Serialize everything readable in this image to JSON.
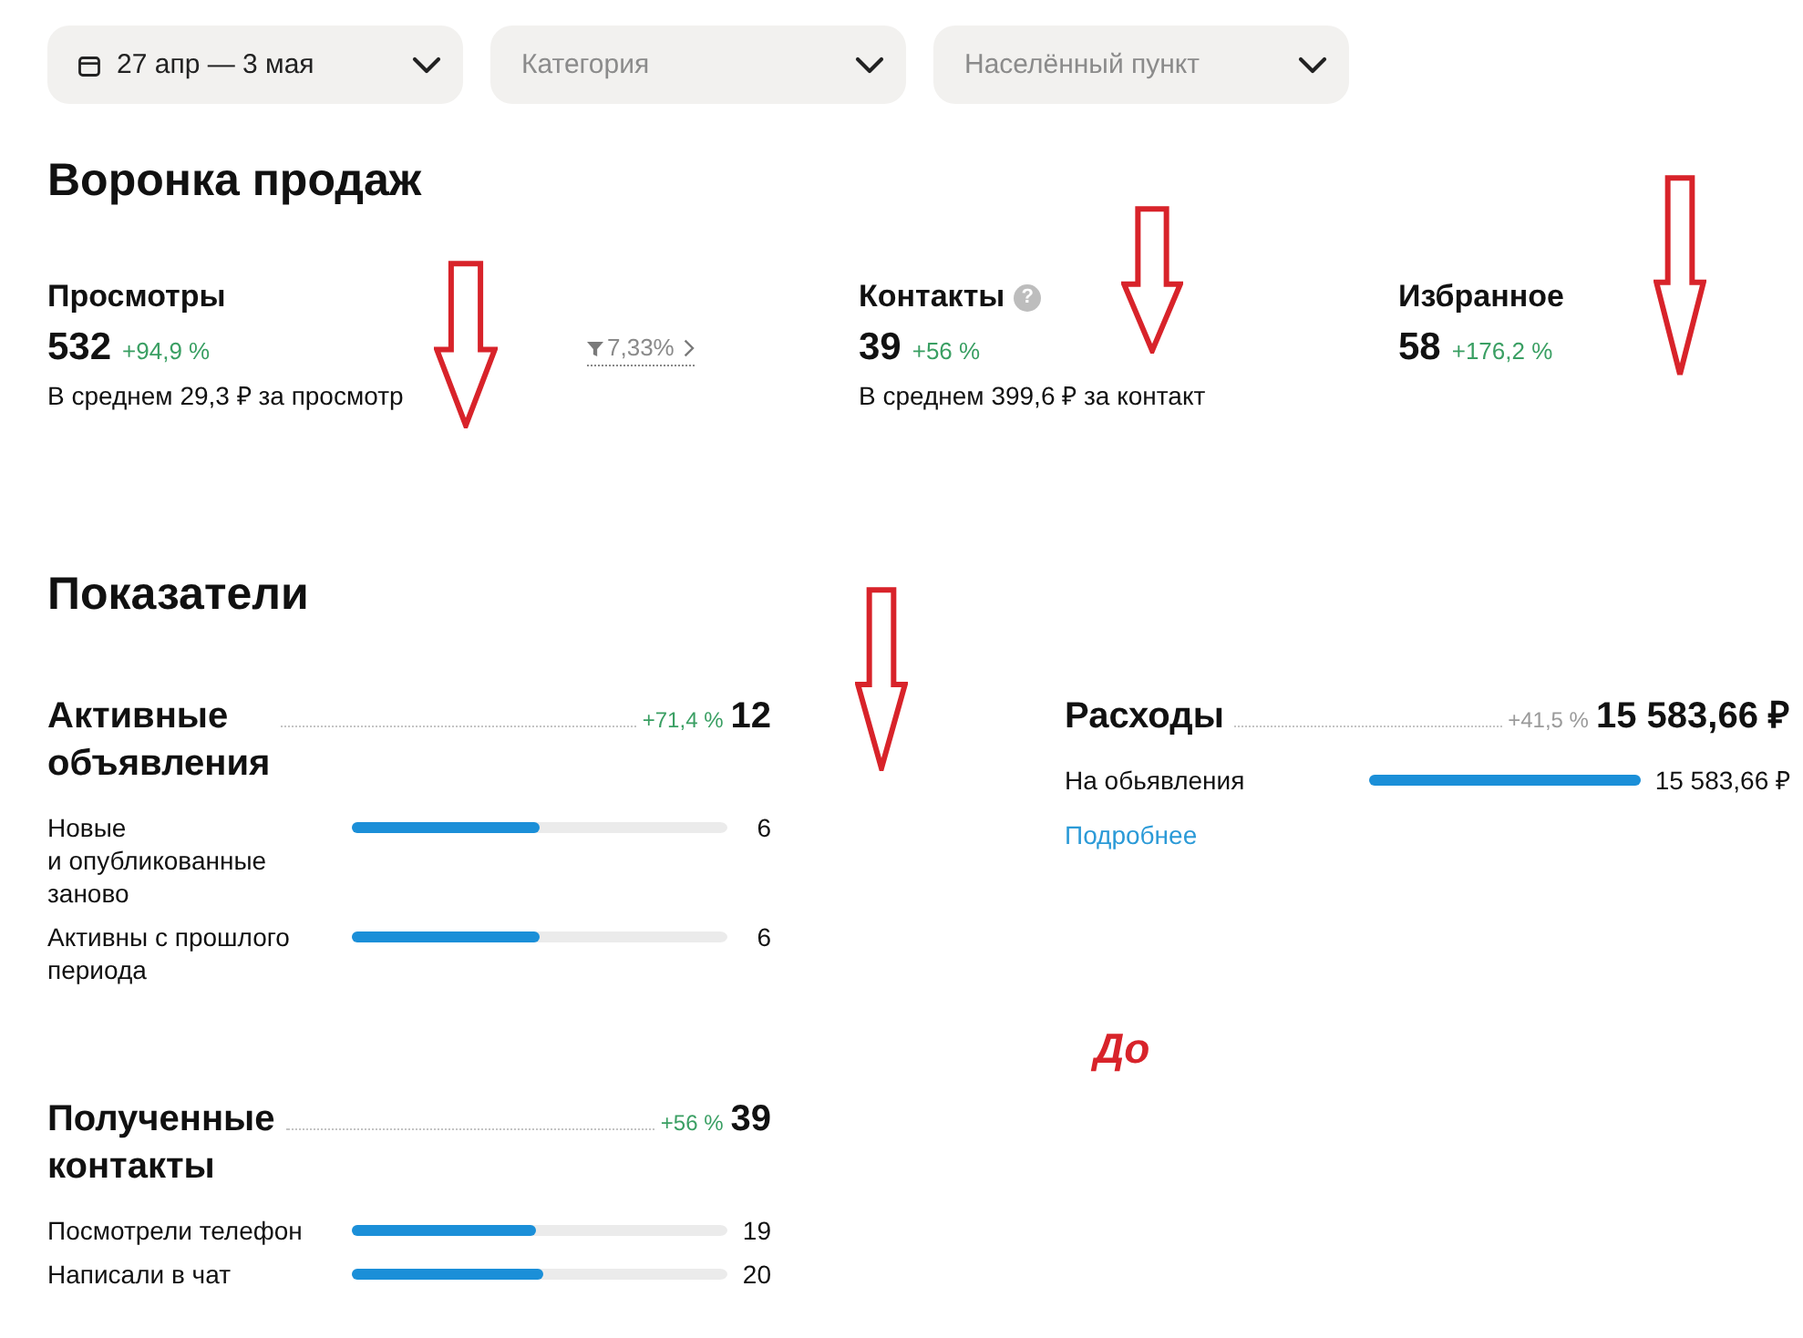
{
  "filters": [
    {
      "kind": "date",
      "value": "27 апр — 3 мая"
    },
    {
      "kind": "select",
      "placeholder": "Категория"
    },
    {
      "kind": "select",
      "placeholder": "Населённый пункт"
    }
  ],
  "funnel": {
    "title": "Воронка продаж",
    "stages": [
      {
        "label": "Просмотры",
        "value": "532",
        "change": "+94,9 %",
        "note": "В среднем 29,3 ₽ за просмотр",
        "conversion": "7,33%"
      },
      {
        "label": "Контакты",
        "help_icon": "?",
        "value": "39",
        "change": "+56 %",
        "note": "В среднем 399,6 ₽ за контакт"
      },
      {
        "label": "Избранное",
        "value": "58",
        "change": "+176,2 %"
      }
    ]
  },
  "metrics": {
    "title": "Показатели",
    "columns": [
      {
        "groups": [
          {
            "title": "Активные объявления",
            "change": "+71,4 %",
            "color": "#3a9f63",
            "total": "12",
            "rows": [
              {
                "label": "Новые и опубликованные заново",
                "level": 0.5,
                "value": "6"
              },
              {
                "label": "Активны с прошлого периода",
                "level": 0.5,
                "value": "6"
              }
            ]
          },
          {
            "title": "Полученные контакты",
            "change": "+56 %",
            "color": "#3a9f63",
            "total": "39",
            "rows": [
              {
                "label": "Посмотрели телефон",
                "level": 0.49,
                "value": "19"
              },
              {
                "label": "Написали в чат",
                "level": 0.51,
                "value": "20"
              }
            ]
          }
        ]
      },
      {
        "groups": [
          {
            "title": "Расходы",
            "change": "+41,5 %",
            "color": "#9a9a9a",
            "total": "15 583,66 ₽",
            "rows": [
              {
                "label": "На обьявления",
                "level": 1,
                "value": "15 583,66 ₽"
              }
            ],
            "link": "Подробнее"
          }
        ]
      }
    ]
  },
  "annotations": [
    {
      "kind": "arrow"
    },
    {
      "kind": "arrow"
    },
    {
      "kind": "arrow"
    },
    {
      "kind": "arrow"
    },
    {
      "kind": "label",
      "text": "До"
    }
  ]
}
